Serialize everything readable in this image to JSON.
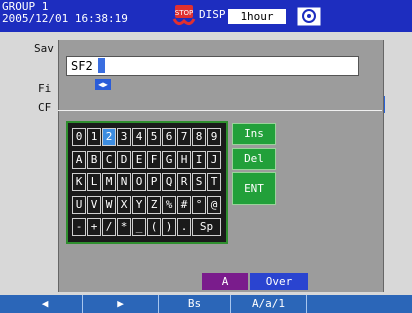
{
  "status": {
    "group": "GROUP 1",
    "datetime": "2005/12/01 16:38:19",
    "disp": "DISP",
    "interval": "1hour",
    "icons": [
      "stop-icon",
      "camera-icon"
    ]
  },
  "background": {
    "labels": {
      "sav": "Sav",
      "fi": "Fi",
      "cf": "CF"
    }
  },
  "dialog": {
    "input_value": "SF2",
    "cursor_arrows": "◀▶",
    "keyboard": {
      "rows": [
        [
          "0",
          "1",
          "2",
          "3",
          "4",
          "5",
          "6",
          "7",
          "8",
          "9"
        ],
        [
          "A",
          "B",
          "C",
          "D",
          "E",
          "F",
          "G",
          "H",
          "I",
          "J"
        ],
        [
          "K",
          "L",
          "M",
          "N",
          "O",
          "P",
          "Q",
          "R",
          "S",
          "T"
        ],
        [
          "U",
          "V",
          "W",
          "X",
          "Y",
          "Z",
          "%",
          "#",
          "°",
          "@"
        ],
        [
          "-",
          "+",
          "/",
          "*",
          "_",
          "(",
          ")",
          ".",
          "Sp"
        ]
      ],
      "selected": "2"
    },
    "functions": {
      "ins": "Ins",
      "del": "Del",
      "ent": "ENT"
    },
    "mode_char": "A",
    "mode_insert": "Over"
  },
  "softkeys": {
    "left": "◀",
    "right": "▶",
    "bs": "Bs",
    "mode": "A/a/1",
    "blank": ""
  },
  "colors": {
    "status_bar": "#1d2dbf",
    "key_selected": "#3d8de0",
    "function_key": "#22a03a",
    "softbar": "#2b66b8"
  }
}
